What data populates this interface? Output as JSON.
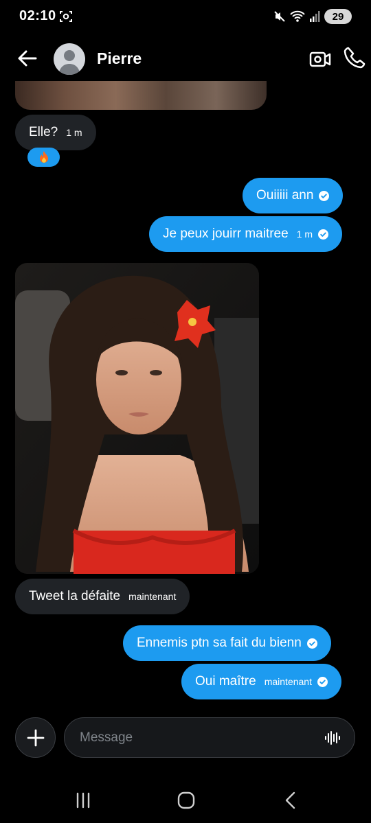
{
  "status_bar": {
    "time": "02:10",
    "battery": "29",
    "icons": [
      "screen-record-icon",
      "mute-icon",
      "wifi-icon",
      "signal-icon",
      "battery-icon"
    ]
  },
  "header": {
    "contact_name": "Pierre",
    "icons": [
      "back-arrow-icon",
      "avatar-icon",
      "video-call-icon",
      "phone-icon"
    ]
  },
  "messages": [
    {
      "kind": "image",
      "side": "in",
      "alt": "photo-partial"
    },
    {
      "kind": "text",
      "side": "in",
      "text": "Elle?",
      "time": "1 m",
      "reaction": "🔥"
    },
    {
      "kind": "text",
      "side": "out",
      "text": "Ouiiiii ann",
      "time": ""
    },
    {
      "kind": "text",
      "side": "out",
      "text": "Je peux jouirr maitree",
      "time": "1 m"
    },
    {
      "kind": "image",
      "side": "in",
      "alt": "photo"
    },
    {
      "kind": "text",
      "side": "in",
      "text": "Tweet la défaite",
      "time": "maintenant"
    },
    {
      "kind": "text",
      "side": "out",
      "text": "Ennemis ptn sa fait du bienn",
      "time": ""
    },
    {
      "kind": "text",
      "side": "out",
      "text": "Oui maître",
      "time": "maintenant"
    }
  ],
  "composer": {
    "placeholder": "Message"
  },
  "colors": {
    "background": "#000000",
    "outgoing_bubble": "#1d9bf0",
    "incoming_bubble": "#202327"
  }
}
